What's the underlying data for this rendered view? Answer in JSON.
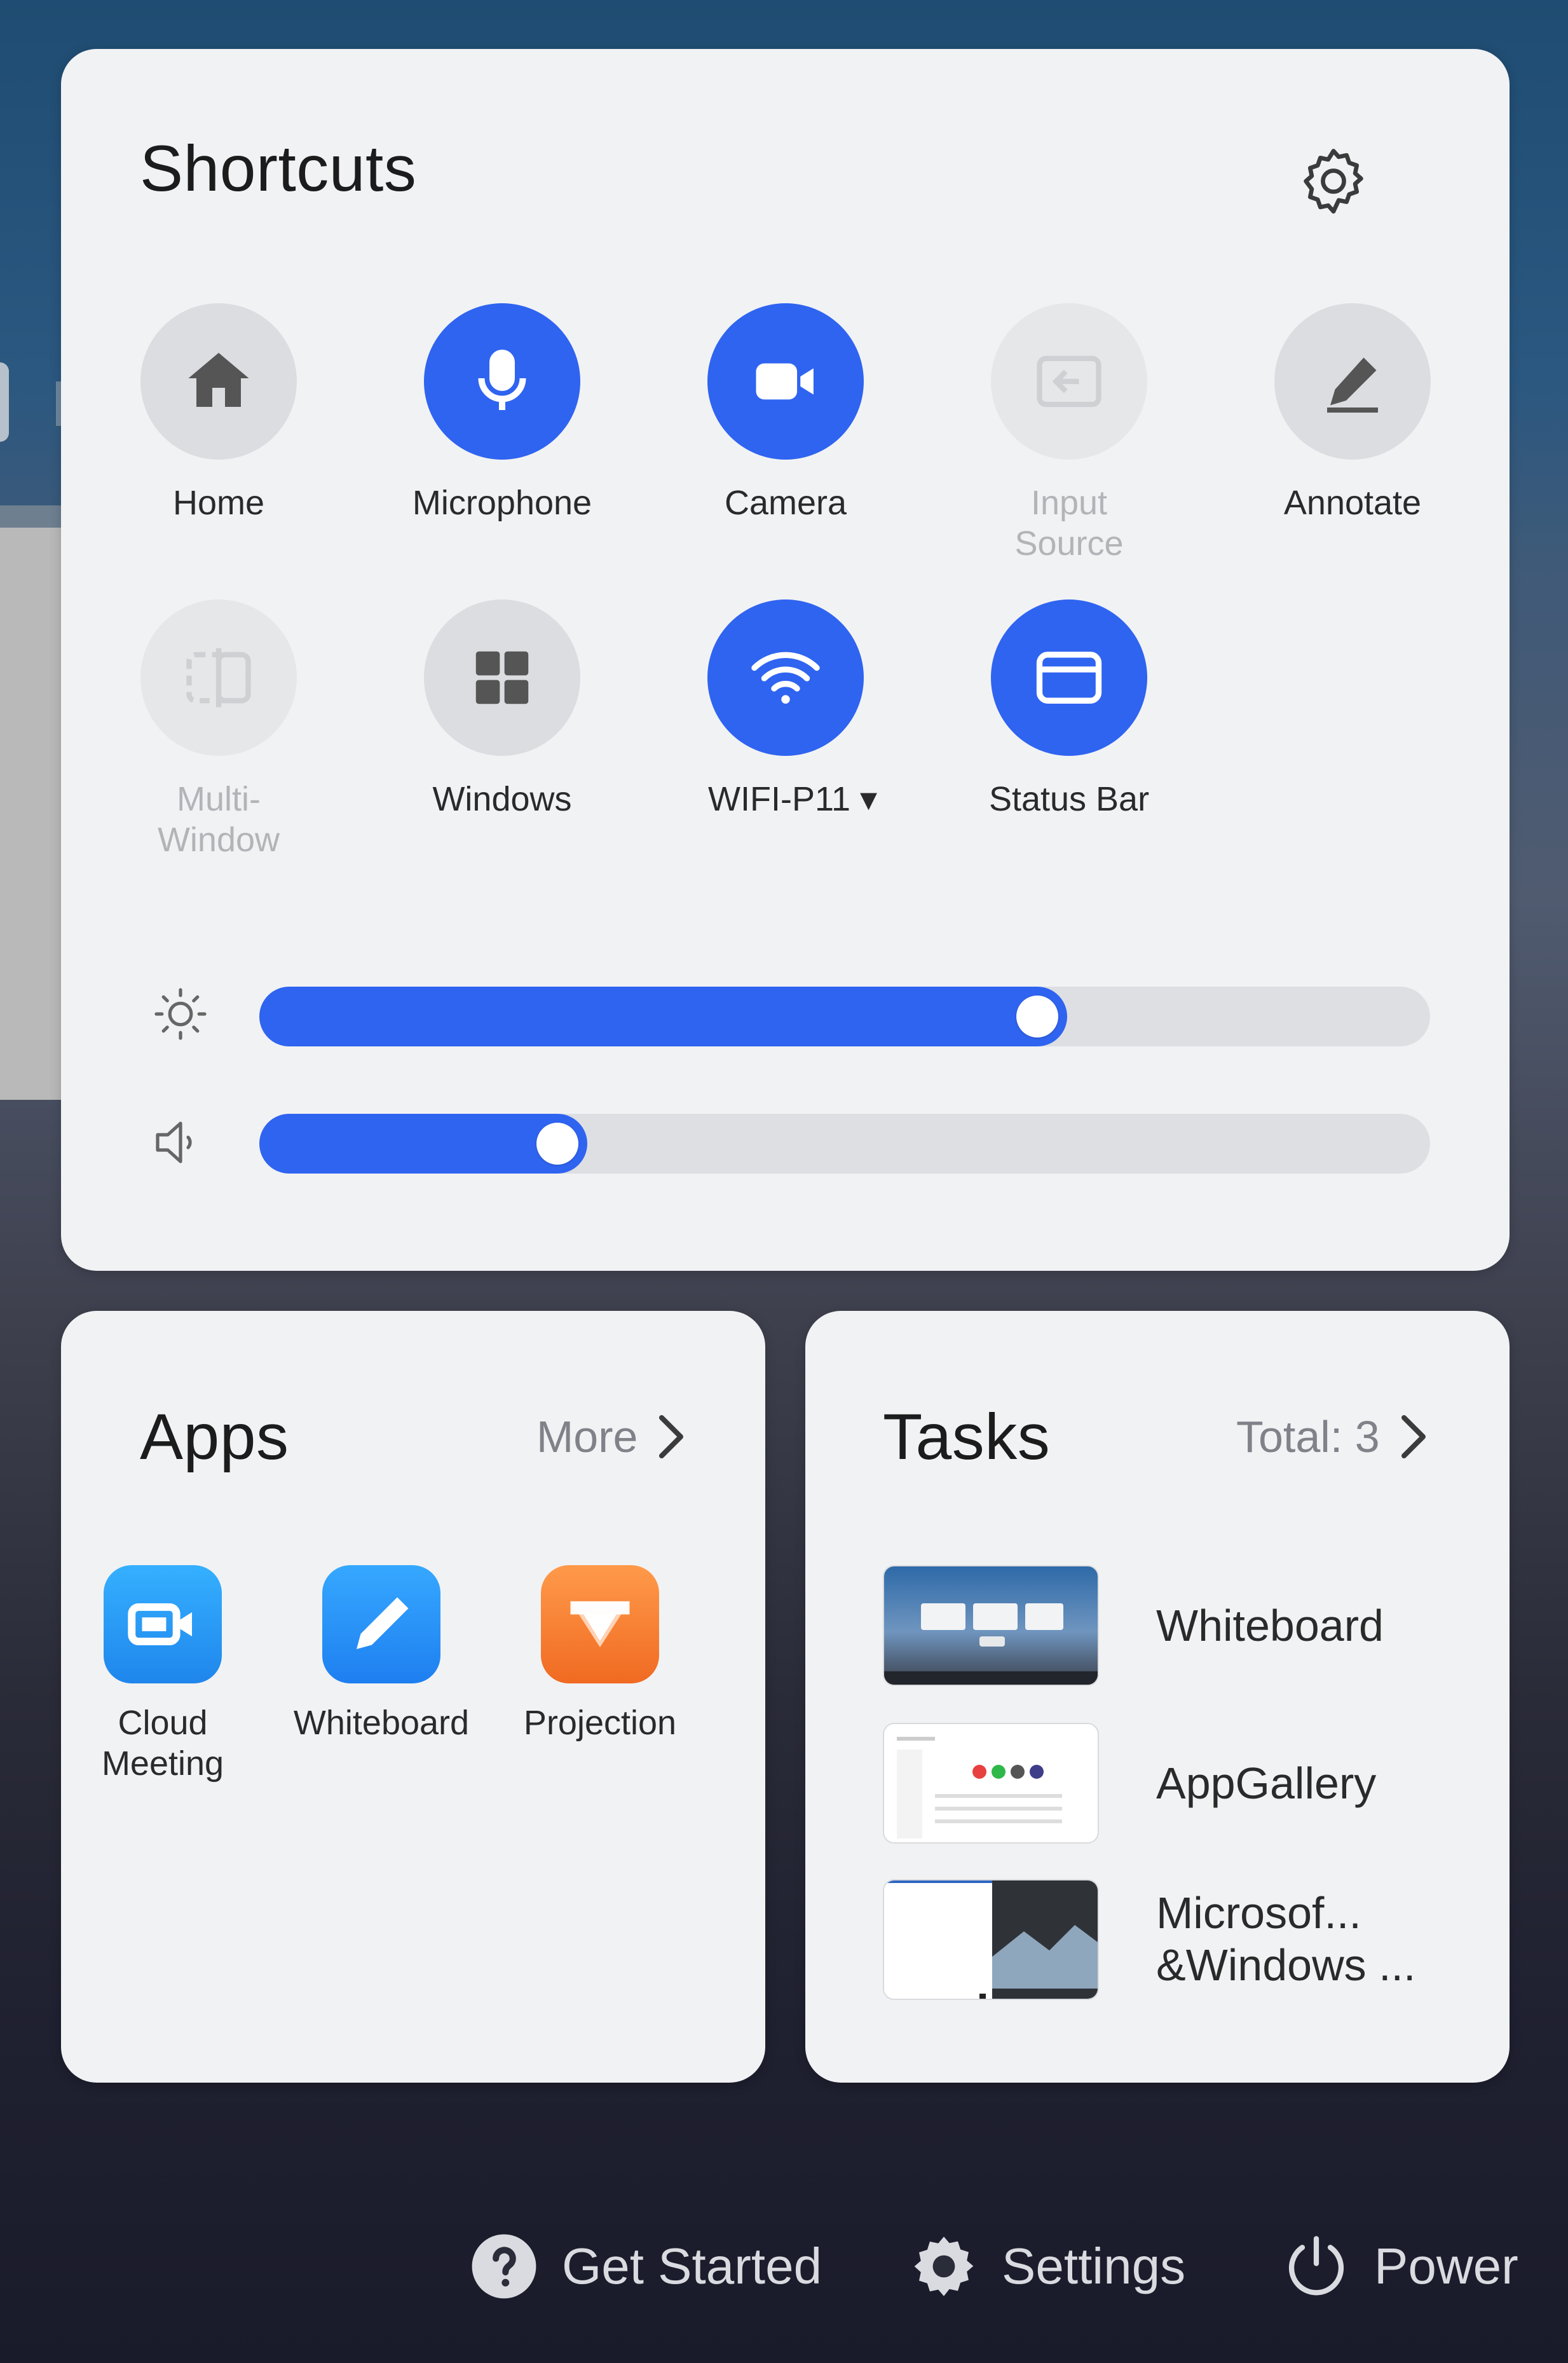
{
  "shortcuts": {
    "title": "Shortcuts",
    "items": [
      {
        "label": "Home",
        "state": "off",
        "icon": "home-icon"
      },
      {
        "label": "Microphone",
        "state": "on",
        "icon": "microphone-icon"
      },
      {
        "label": "Camera",
        "state": "on",
        "icon": "camera-icon"
      },
      {
        "label": "Input Source",
        "state": "disabled",
        "icon": "input-source-icon"
      },
      {
        "label": "Annotate",
        "state": "off",
        "icon": "pen-icon"
      },
      {
        "label": "Multi-\nWindow",
        "state": "disabled",
        "icon": "multi-window-icon"
      },
      {
        "label": "Windows",
        "state": "off",
        "icon": "windows-icon"
      },
      {
        "label": "WIFI-P11 ▾",
        "state": "on",
        "icon": "wifi-icon"
      },
      {
        "label": "Status Bar",
        "state": "on",
        "icon": "status-bar-icon"
      }
    ],
    "brightness_level": 0.69,
    "volume_level": 0.28
  },
  "apps": {
    "title": "Apps",
    "more_label": "More",
    "items": [
      {
        "label": "Cloud\nMeeting",
        "icon": "cloud-meeting-icon"
      },
      {
        "label": "Whiteboard",
        "icon": "whiteboard-icon"
      },
      {
        "label": "Projection",
        "icon": "projection-icon"
      }
    ]
  },
  "tasks": {
    "title": "Tasks",
    "total_label": "Total: 3",
    "items": [
      {
        "label": "Whiteboard"
      },
      {
        "label": "AppGallery"
      },
      {
        "label": "Microsof...\n&Windows ..."
      }
    ]
  },
  "bottom": {
    "get_started": "Get Started",
    "settings": "Settings",
    "power": "Power"
  },
  "colors": {
    "accent": "#2f64f0",
    "card": "#f1f2f4",
    "cloud_meeting": "#1f97ef",
    "whiteboard": "#2a8ef0",
    "projection": "#f57a33"
  }
}
